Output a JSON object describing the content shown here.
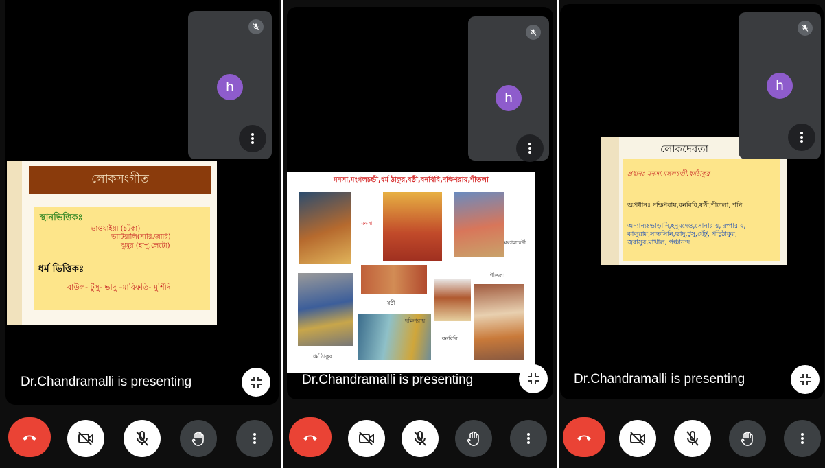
{
  "panels": [
    {
      "presenting_text": "Dr.Chandramalli is presenting",
      "avatar_letter": "h",
      "slide": {
        "title": "লোকসংগীত",
        "section1_heading": "স্থানভিত্তিকঃ",
        "section1_lines": [
          "ভাওয়াইয়া (চটকা)",
          "ভাটিয়ালি(সারি,জারি)",
          "ঝুমুর (হাপু,লেটো)"
        ],
        "section2_heading": "ধর্ম ভিত্তিকঃ",
        "section2_line": "বাউল- টুসু- ভাদু –মারিফতি- মুর্শিদি"
      }
    },
    {
      "presenting_text": "Dr.Chandramalli is presenting",
      "avatar_letter": "h",
      "slide": {
        "title": "মনসা,মংগলচন্ডী,ধর্ম ঠাকুর,ষষ্ঠী,বনবিবি,দক্ষিণরায়,শীতলা",
        "captions": {
          "manasa": "মনসা",
          "mangalchandi": "মংগলচন্ডী",
          "sitala": "শীতলা",
          "shashthi": "ষষ্ঠী",
          "dakshinray": "দক্ষিণরায়",
          "banbibi": "বনবিবি",
          "dharma_thakur": "ধর্ম ঠাকুর"
        }
      }
    },
    {
      "presenting_text": "Dr.Chandramalli is presenting",
      "avatar_letter": "h",
      "slide": {
        "title": "লোকদেবতা",
        "item1": "প্রধানঃ মনসা,মঙ্গলচণ্ডী,ধর্মঠাকুর",
        "item2": "অপ্রধানঃ দক্ষিণরায়,বনবিবি,ষষ্ঠী,শীতলা, শনি",
        "item3": "অন্যান্যঃভাড়ানি,হনুমদেও,সোনারায়, রুপারায়, কালুরায়,সাতসিনি,ভাদু,টুসু,ঘেঁটু, পাঁচুঠাকুর, জ্বরাসুর,মাখাল, পঞ্চানন্দ"
      }
    }
  ],
  "colors": {
    "end_call": "#ea4335",
    "avatar": "#8e5ccc",
    "tile": "#3a3c3f"
  },
  "icons": {
    "end_call": "phone-hangup-icon",
    "camera": "camera-off-icon",
    "mic": "mic-off-icon",
    "hand": "raise-hand-icon",
    "more": "more-vert-icon",
    "exit": "exit-fullscreen-icon"
  }
}
